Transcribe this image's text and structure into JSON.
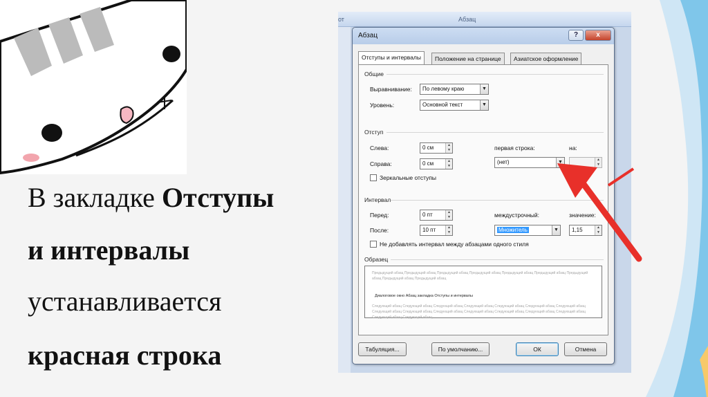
{
  "slide": {
    "line1_pre": "В закладке ",
    "line1_bold": "Отступы",
    "line2": "и интервалы",
    "line3": "устанавливается",
    "line4": "красная строка"
  },
  "ribbon": {
    "left_fragment": "от",
    "center_label": "Абзац"
  },
  "dialog": {
    "title": "Абзац",
    "help_label": "?",
    "close_label": "x",
    "tabs": [
      {
        "label": "Отступы и интервалы",
        "active": true
      },
      {
        "label": "Положение на странице",
        "active": false
      },
      {
        "label": "Азиатское оформление",
        "active": false
      }
    ],
    "general": {
      "heading": "Общие",
      "alignment_label": "Выравнивание:",
      "alignment_value": "По левому краю",
      "level_label": "Уровень:",
      "level_value": "Основной текст"
    },
    "indent": {
      "heading": "Отступ",
      "left_label": "Слева:",
      "left_value": "0 см",
      "right_label": "Справа:",
      "right_value": "0 см",
      "first_line_label": "первая строка:",
      "first_line_value": "(нет)",
      "by_label": "на:",
      "by_value": "",
      "mirror_label": "Зеркальные отступы",
      "mirror_checked": false
    },
    "spacing": {
      "heading": "Интервал",
      "before_label": "Перед:",
      "before_value": "0 пт",
      "after_label": "После:",
      "after_value": "10 пт",
      "line_label": "междустрочный:",
      "line_value": "Множитель",
      "value_label": "значение:",
      "value_value": "1,15",
      "no_space_label": "Не добавлять интервал между абзацами одного стиля",
      "no_space_checked": false
    },
    "preview": {
      "heading": "Образец",
      "prev_text": "Предыдущий абзац Предыдущий абзац Предыдущий абзац Предыдущий абзац Предыдущий абзац Предыдущий абзац Предыдущий абзац Предыдущий абзац Предыдущий абзац",
      "sample_text": "Диалоговое окно Абзац закладка Отступы и интервалы",
      "next_text": "Следующий абзац Следующий абзац Следующий абзац Следующий абзац Следующий абзац Следующий абзац Следующий абзац Следующий абзац Следующий абзац Следующий абзац Следующий абзац Следующий абзац Следующий абзац Следующий абзац Следующий абзац Следующий абзац"
    },
    "buttons": {
      "tabs_label": "Табуляция...",
      "default_label": "По умолчанию...",
      "ok_label": "ОК",
      "cancel_label": "Отмена"
    }
  },
  "colors": {
    "arrow": "#e8302a",
    "accent": "#3399ff"
  }
}
